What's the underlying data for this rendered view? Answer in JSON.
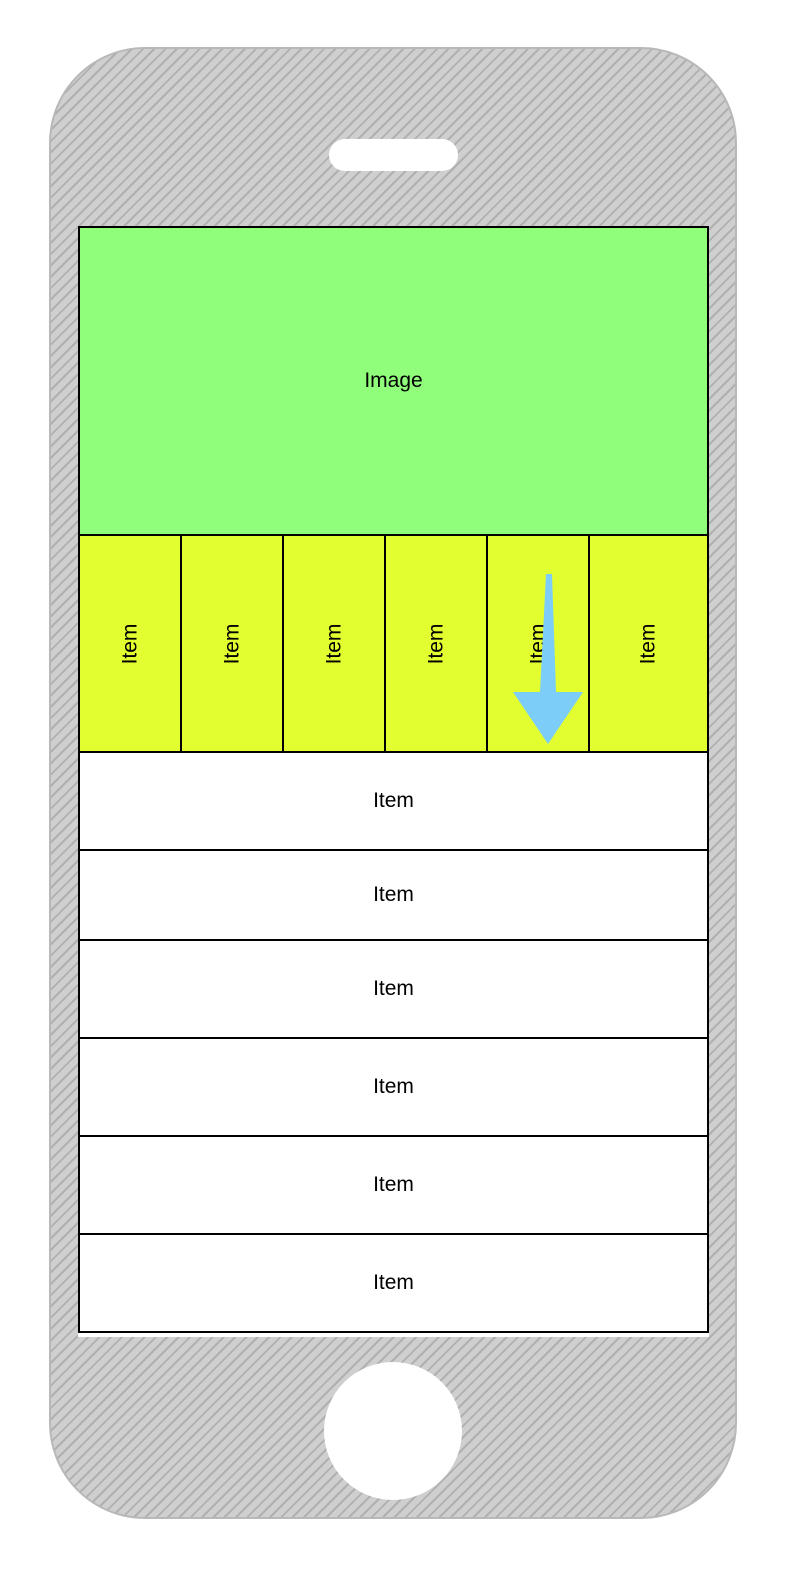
{
  "screen": {
    "image_label": "Image",
    "tabs": [
      "Item",
      "Item",
      "Item",
      "Item",
      "Item",
      "Item"
    ],
    "list": [
      "Item",
      "Item",
      "Item",
      "Item",
      "Item",
      "Item"
    ]
  },
  "colors": {
    "image_fill": "#90fd7b",
    "tab_fill": "#e3fe30",
    "arrow": "#7dcdf9",
    "phone_body": "#cfcfcf"
  },
  "icons": {
    "arrow": "arrow-down-icon"
  }
}
